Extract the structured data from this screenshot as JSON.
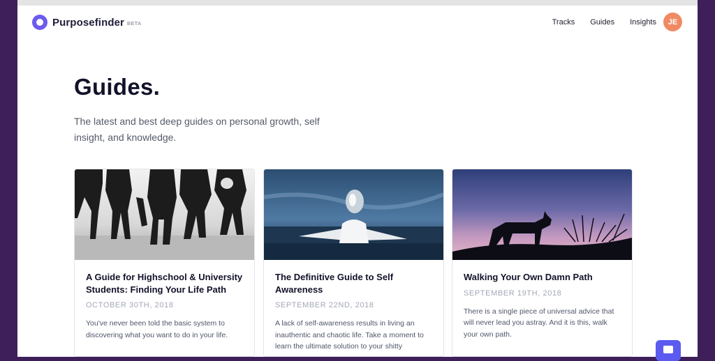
{
  "brand": {
    "name": "Purposefinder",
    "badge": "BETA"
  },
  "nav": {
    "items": [
      "Tracks",
      "Guides",
      "Insights"
    ],
    "avatar_initials": "JE"
  },
  "page": {
    "title": "Guides.",
    "subtitle": "The latest and best deep guides on personal growth, self insight, and knowledge."
  },
  "guides": [
    {
      "title": "A Guide for Highschool & University Students: Finding Your Life Path",
      "date": "OCTOBER 30TH, 2018",
      "excerpt": "You've never been told the basic system to discovering what you want to do in your life.",
      "image": "students-walking-photo"
    },
    {
      "title": "The Definitive Guide to Self Awareness",
      "date": "SEPTEMBER 22ND, 2018",
      "excerpt": "A lack of self-awareness results in living an inauthentic and chaotic life. Take a moment to learn the ultimate solution to your shitty",
      "image": "mirror-head-ocean-photo"
    },
    {
      "title": "Walking Your Own Damn Path",
      "date": "SEPTEMBER 19TH, 2018",
      "excerpt": "There is a single piece of universal advice that will never lead you astray. And it is this, walk your own path.",
      "image": "wolf-silhouette-dusk-photo"
    }
  ],
  "colors": {
    "accent": "#6a5bf0",
    "avatar": "#f08a63",
    "backdrop": "#3f1f5a",
    "chat_button": "#5b5bf0"
  },
  "widgets": {
    "chat_icon": "chat-bubble-icon"
  }
}
